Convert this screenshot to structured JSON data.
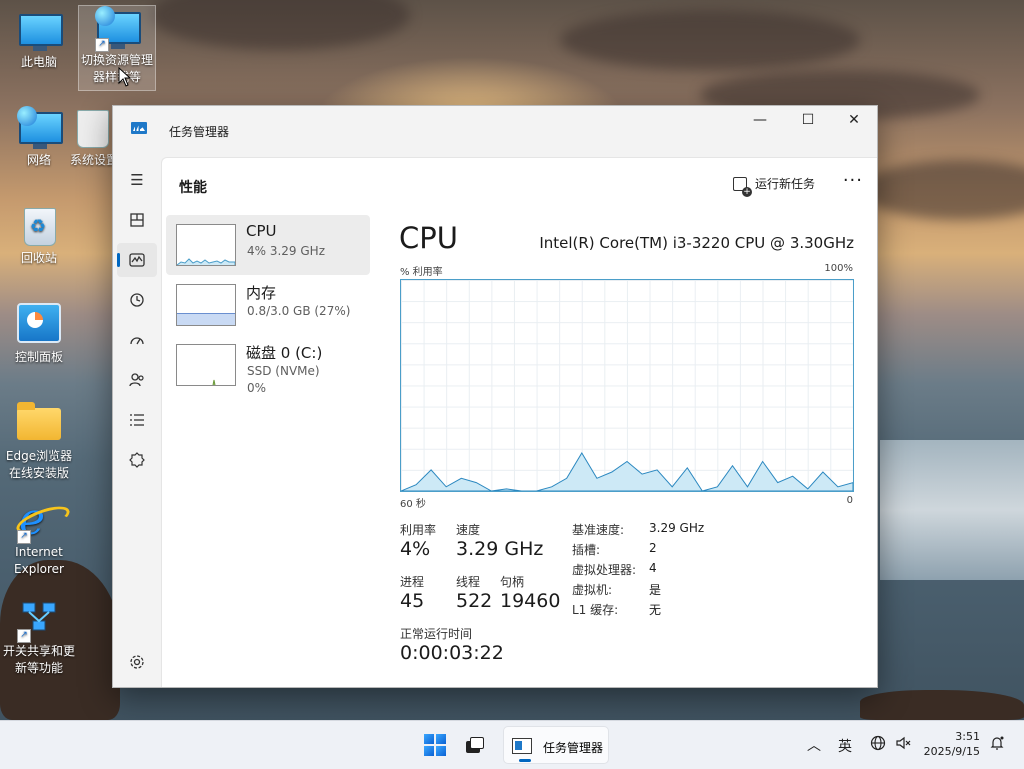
{
  "desktop": {
    "icons": [
      {
        "label": "此电脑"
      },
      {
        "label": "切换资源管理器样式等"
      },
      {
        "label": "网络"
      },
      {
        "label": "系统设置"
      },
      {
        "label": "回收站"
      },
      {
        "label": "控制面板"
      },
      {
        "label": "Edge浏览器在线安装版"
      },
      {
        "label": "Internet Explorer"
      },
      {
        "label": "开关共享和更新等功能"
      }
    ]
  },
  "window": {
    "title": "任务管理器",
    "controls": {
      "minimize": "—",
      "maximize": "☐",
      "close": "✕"
    }
  },
  "nav": {
    "items": [
      {
        "icon": "hamburger-icon"
      },
      {
        "icon": "processes-icon"
      },
      {
        "icon": "performance-icon"
      },
      {
        "icon": "app-history-icon"
      },
      {
        "icon": "startup-apps-icon"
      },
      {
        "icon": "users-icon"
      },
      {
        "icon": "details-icon"
      },
      {
        "icon": "services-icon"
      },
      {
        "icon": "settings-icon"
      }
    ]
  },
  "header": {
    "title": "性能",
    "run_task": "运行新任务",
    "more": "···"
  },
  "perf_list": [
    {
      "name": "CPU",
      "sub1": "4%  3.29 GHz",
      "sub2": ""
    },
    {
      "name": "内存",
      "sub1": "0.8/3.0 GB (27%)",
      "sub2": ""
    },
    {
      "name": "磁盘 0 (C:)",
      "sub1": "SSD (NVMe)",
      "sub2": "0%"
    }
  ],
  "cpu": {
    "title": "CPU",
    "model": "Intel(R) Core(TM) i3-3220 CPU @ 3.30GHz",
    "y_label": "% 利用率",
    "y_max": "100%",
    "x_left": "60 秒",
    "x_right": "0",
    "stats": {
      "utilization_label": "利用率",
      "utilization": "4%",
      "speed_label": "速度",
      "speed": "3.29 GHz",
      "processes_label": "进程",
      "processes": "45",
      "threads_label": "线程",
      "threads": "522",
      "handles_label": "句柄",
      "handles": "19460",
      "uptime_label": "正常运行时间",
      "uptime": "0:00:03:22"
    },
    "details": [
      {
        "k": "基准速度:",
        "v": "3.29 GHz"
      },
      {
        "k": "插槽:",
        "v": "2"
      },
      {
        "k": "虚拟处理器:",
        "v": "4"
      },
      {
        "k": "虚拟机:",
        "v": "是"
      },
      {
        "k": "L1 缓存:",
        "v": "无"
      }
    ]
  },
  "chart_data": {
    "type": "area",
    "ylim": [
      0,
      100
    ],
    "x": [
      60,
      58,
      56,
      54,
      52,
      50,
      48,
      46,
      44,
      42,
      40,
      38,
      36,
      34,
      32,
      30,
      28,
      26,
      24,
      22,
      20,
      18,
      16,
      14,
      12,
      10,
      8,
      6,
      4,
      2,
      0
    ],
    "values": [
      0,
      3,
      10,
      2,
      6,
      4,
      0,
      1,
      0,
      0,
      2,
      6,
      18,
      6,
      9,
      14,
      8,
      10,
      2,
      11,
      0,
      2,
      12,
      2,
      14,
      4,
      7,
      1,
      9,
      2,
      4
    ]
  },
  "taskbar": {
    "app_label": "任务管理器",
    "ime": "英",
    "time": "3:51",
    "date": "2025/9/15",
    "colors": {
      "accent": "#0067c0"
    }
  }
}
